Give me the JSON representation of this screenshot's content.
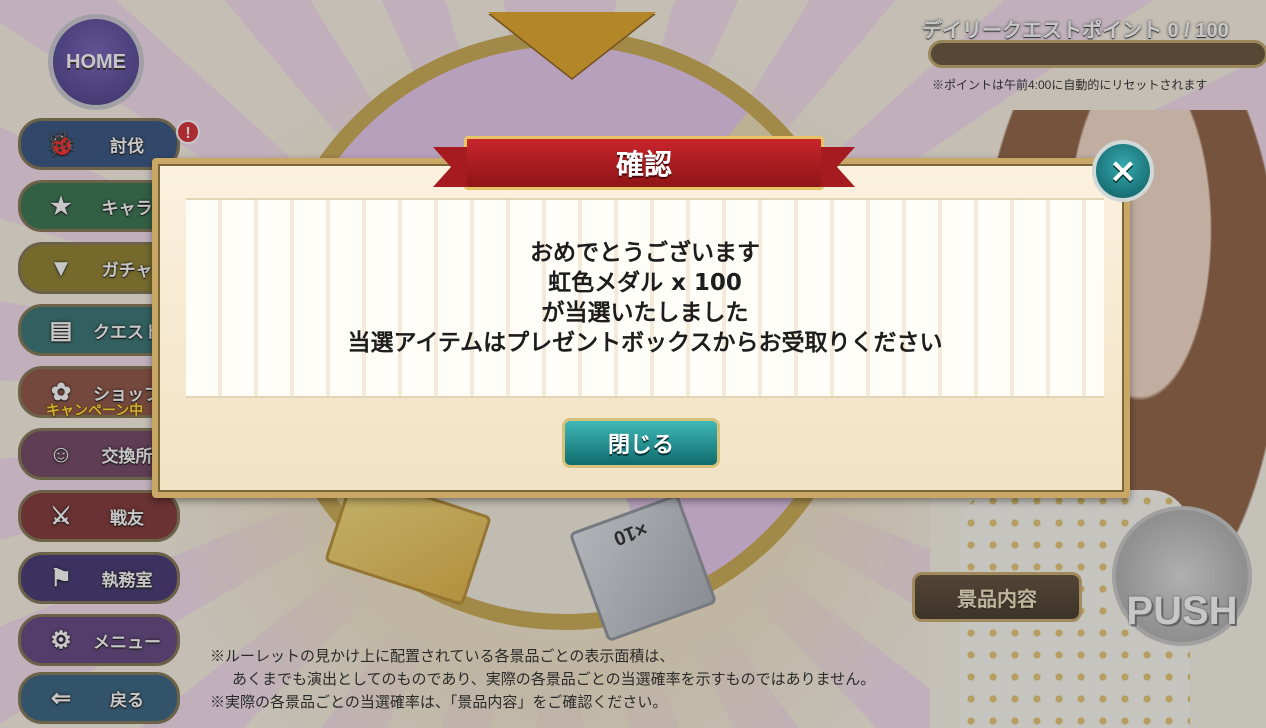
{
  "home": {
    "label": "HOME"
  },
  "side_menu": {
    "items": [
      {
        "label": "討伐",
        "icon": "bug-icon"
      },
      {
        "label": "キャラ",
        "icon": "characters-icon"
      },
      {
        "label": "ガチャ",
        "icon": "pot-icon"
      },
      {
        "label": "クエスト",
        "icon": "scroll-icon"
      },
      {
        "label": "ショップ",
        "icon": "flower-icon"
      },
      {
        "label": "交換所",
        "icon": "girl-icon"
      },
      {
        "label": "戦友",
        "icon": "swords-icon"
      },
      {
        "label": "執務室",
        "icon": "banner-icon"
      },
      {
        "label": "メニュー",
        "icon": "gear-icon"
      },
      {
        "label": "戻る",
        "icon": "back-arrow-icon"
      }
    ],
    "alert_badge": "!",
    "shop_campaign": "キャンペーン中"
  },
  "daily_quest": {
    "label": "デイリークエストポイント 0 / 100",
    "progress": 0,
    "note": "※ポイントは午前4:00に自動的にリセットされます"
  },
  "roulette": {
    "prize_count_label": "×10"
  },
  "prize_list_button": "景品内容",
  "push_button": "PUSH",
  "footnotes": [
    "※ルーレットの見かけ上に配置されている各景品ごとの表示面積は、",
    "あくまでも演出としてのものであり、実際の各景品ごとの当選確率を示すものではありません。",
    "※実際の各景品ごとの当選確率は、「景品内容」をご確認ください。"
  ],
  "dialog": {
    "title": "確認",
    "close_icon": "×",
    "message": [
      "おめでとうございます",
      "虹色メダル x 100",
      "が当選いたしました",
      "当選アイテムはプレゼントボックスからお受取りください"
    ],
    "close_button": "閉じる"
  },
  "colors": {
    "ribbon": "#b51f24",
    "close_button": "#1f8a8b",
    "dialog_border": "#c9a865"
  }
}
